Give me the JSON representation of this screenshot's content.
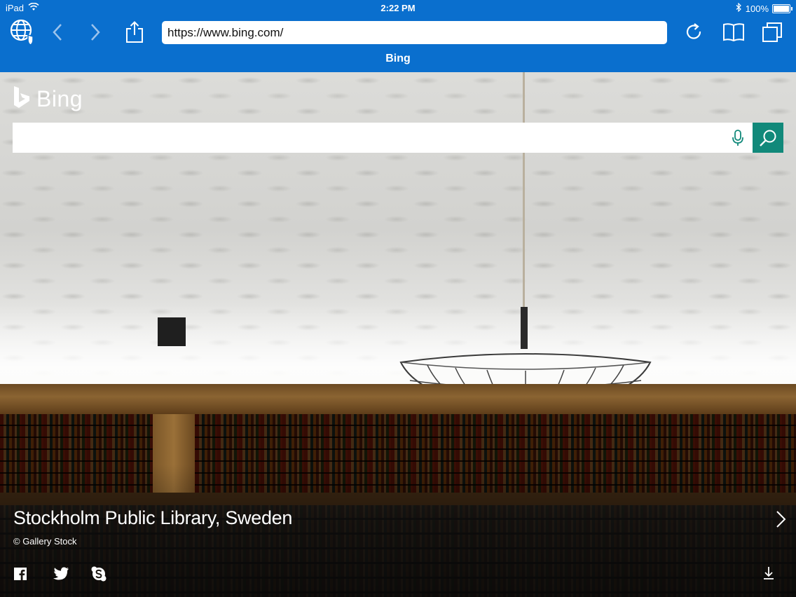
{
  "status_bar": {
    "device": "iPad",
    "time": "2:22 PM",
    "battery": "100%"
  },
  "browser": {
    "url": "https://www.bing.com/",
    "page_title": "Bing",
    "accent_color": "#0a6fce",
    "icons": [
      "globe-shield-icon",
      "back-icon",
      "forward-icon",
      "share-icon",
      "reload-icon",
      "bookmarks-icon",
      "tabs-icon"
    ]
  },
  "bing": {
    "logo_text": "Bing",
    "search_placeholder": "",
    "search_button_color": "#11897a",
    "image_caption": "Stockholm Public Library, Sweden",
    "image_credit": "© Gallery Stock",
    "social_icons": [
      "facebook-icon",
      "twitter-icon",
      "skype-icon"
    ],
    "download_icon": "download-icon"
  }
}
